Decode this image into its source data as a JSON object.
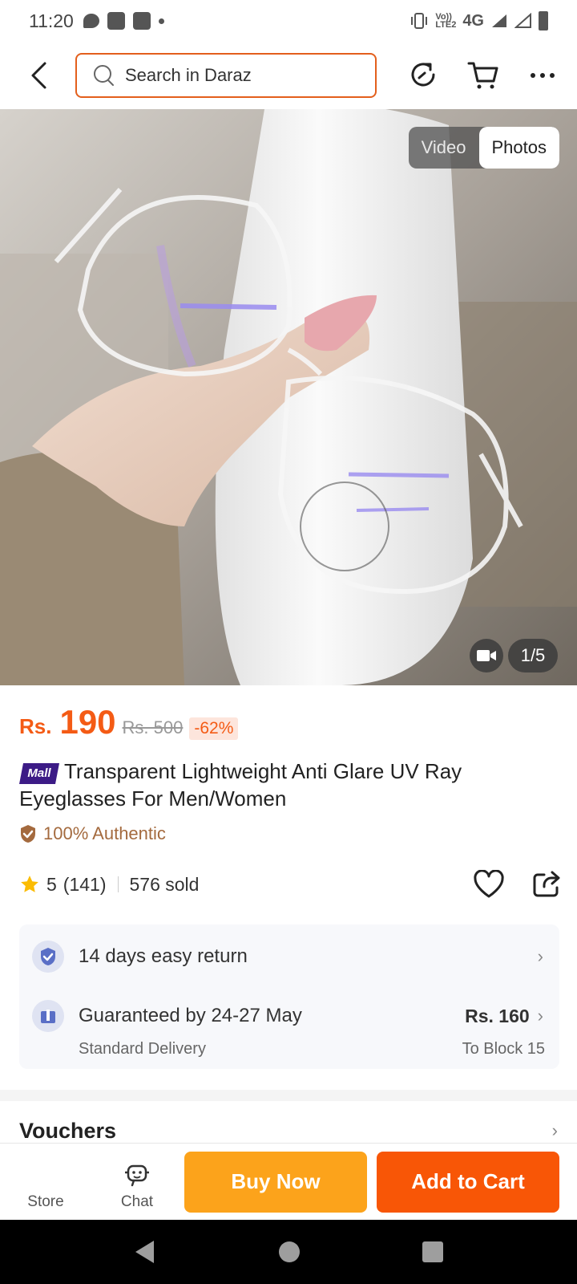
{
  "status_bar": {
    "time": "11:20",
    "network": "4G",
    "volte": "Vo)) LTE2"
  },
  "header": {
    "search_placeholder": "Search in Daraz",
    "icons": [
      "back-icon",
      "search-icon",
      "share-icon",
      "cart-icon",
      "more-icon"
    ]
  },
  "gallery": {
    "tab_video": "Video",
    "tab_photos": "Photos",
    "active_tab": "Photos",
    "counter": "1/5"
  },
  "product": {
    "currency": "Rs.",
    "price": "190",
    "original_price": "Rs. 500",
    "discount": "-62%",
    "mall_badge": "Mall",
    "title": "Transparent Lightweight Anti Glare UV Ray Eyeglasses For Men/Women",
    "authentic": "100% Authentic",
    "rating": "5",
    "review_count": "(141)",
    "sold": "576 sold"
  },
  "delivery": {
    "return_text": "14 days easy return",
    "guarantee_text": "Guaranteed by 24-27 May",
    "delivery_type": "Standard Delivery",
    "fee": "Rs. 160",
    "destination": "To Block 15"
  },
  "vouchers": {
    "title": "Vouchers"
  },
  "bottom_bar": {
    "store": "Store",
    "chat": "Chat",
    "buy_now": "Buy Now",
    "add_to_cart": "Add to Cart"
  },
  "colors": {
    "accent": "#f85606",
    "buy_now": "#fca31b",
    "search_border": "#e35f1c",
    "mall": "#3c1b86",
    "authentic": "#a46a3e"
  }
}
